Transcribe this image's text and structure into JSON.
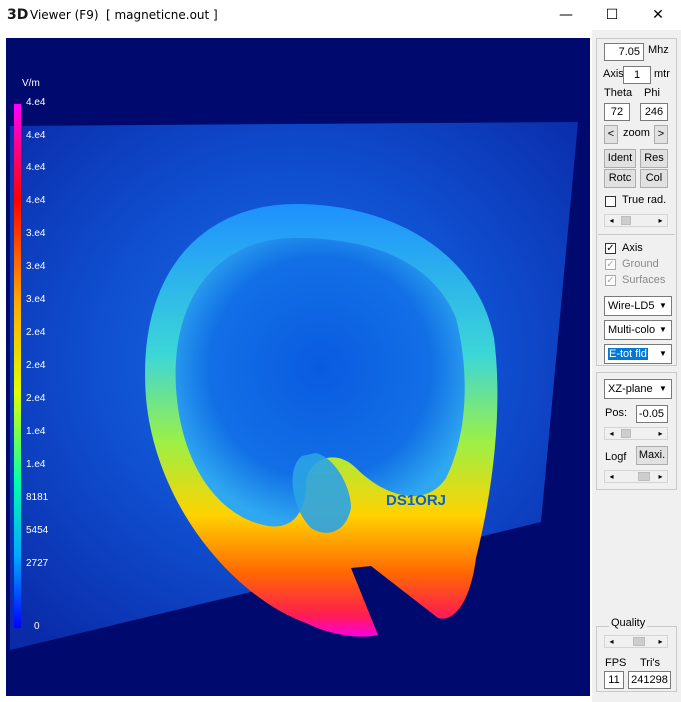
{
  "window": {
    "logo": "3D",
    "title": "Viewer (F9)",
    "file": "[  magneticne.out ]",
    "minimize_glyph": "—",
    "maximize_glyph": "☐",
    "close_glyph": "✕"
  },
  "legend": {
    "unit": "V/m",
    "labels": [
      "4.e4",
      "4.e4",
      "4.e4",
      "4.e4",
      "3.e4",
      "3.e4",
      "3.e4",
      "2.e4",
      "2.e4",
      "2.e4",
      "1.e4",
      "1.e4",
      "8181",
      "5454",
      "2727",
      "0"
    ]
  },
  "viewport": {
    "callsign": "DS1ORJ"
  },
  "panel": {
    "freq_value": "7.05",
    "freq_unit": "Mhz",
    "axis_label": "Axis",
    "axis_value": "1",
    "axis_unit": "mtr",
    "theta_label": "Theta",
    "phi_label": "Phi",
    "theta_value": "72",
    "phi_value": "246",
    "zoom_left": "<",
    "zoom_label": "zoom",
    "zoom_right": ">",
    "ident": "Ident",
    "res": "Res",
    "rotc": "Rotc",
    "col": "Col",
    "true_rad": "True rad.",
    "axis_check": "Axis",
    "ground_check": "Ground",
    "surfaces_check": "Surfaces",
    "combo_wire": "Wire-LD5",
    "combo_color": "Multi-colo",
    "combo_field": "E-tot fld",
    "combo_plane": "XZ-plane",
    "pos_label": "Pos:",
    "pos_value": "-0.05",
    "logf_label": "Logf",
    "maxi": "Maxi.",
    "quality_label": "Quality",
    "fps_label": "FPS",
    "tris_label": "Tri's",
    "fps_value": "11",
    "tris_value": "241298"
  }
}
